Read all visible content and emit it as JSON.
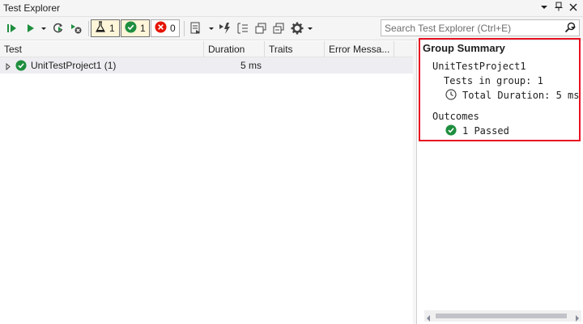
{
  "window": {
    "title": "Test Explorer"
  },
  "toolbar": {
    "filters": [
      {
        "name": "tests-filter",
        "count": "1"
      },
      {
        "name": "passed-filter",
        "count": "1"
      },
      {
        "name": "failed-filter",
        "count": "0"
      }
    ]
  },
  "search": {
    "placeholder": "Search Test Explorer (Ctrl+E)"
  },
  "columns": [
    "Test",
    "Duration",
    "Traits",
    "Error Messa..."
  ],
  "rows": [
    {
      "name": "UnitTestProject1 (1)",
      "duration": "5 ms",
      "status": "passed"
    }
  ],
  "summary": {
    "title": "Group Summary",
    "group": "UnitTestProject1",
    "tests_in_group": "Tests in group: 1",
    "total_duration": "Total Duration: 5 ms",
    "outcomes_label": "Outcomes",
    "passed": "1 Passed"
  },
  "colors": {
    "highlight_border": "#e81123",
    "passed": "#1e8e3e",
    "failed": "#e51400",
    "accent": "#1a6fc1"
  },
  "icons": [
    "pin-icon",
    "close-icon",
    "run-all-icon",
    "run-icon",
    "rerun-failed-icon",
    "cancel-icon",
    "flask-icon",
    "checkmark-icon",
    "error-icon",
    "playlist-icon",
    "live-unit-test-icon",
    "group-by-icon",
    "expand-icon",
    "collapse-icon",
    "settings-icon",
    "search-icon",
    "clock-icon"
  ]
}
